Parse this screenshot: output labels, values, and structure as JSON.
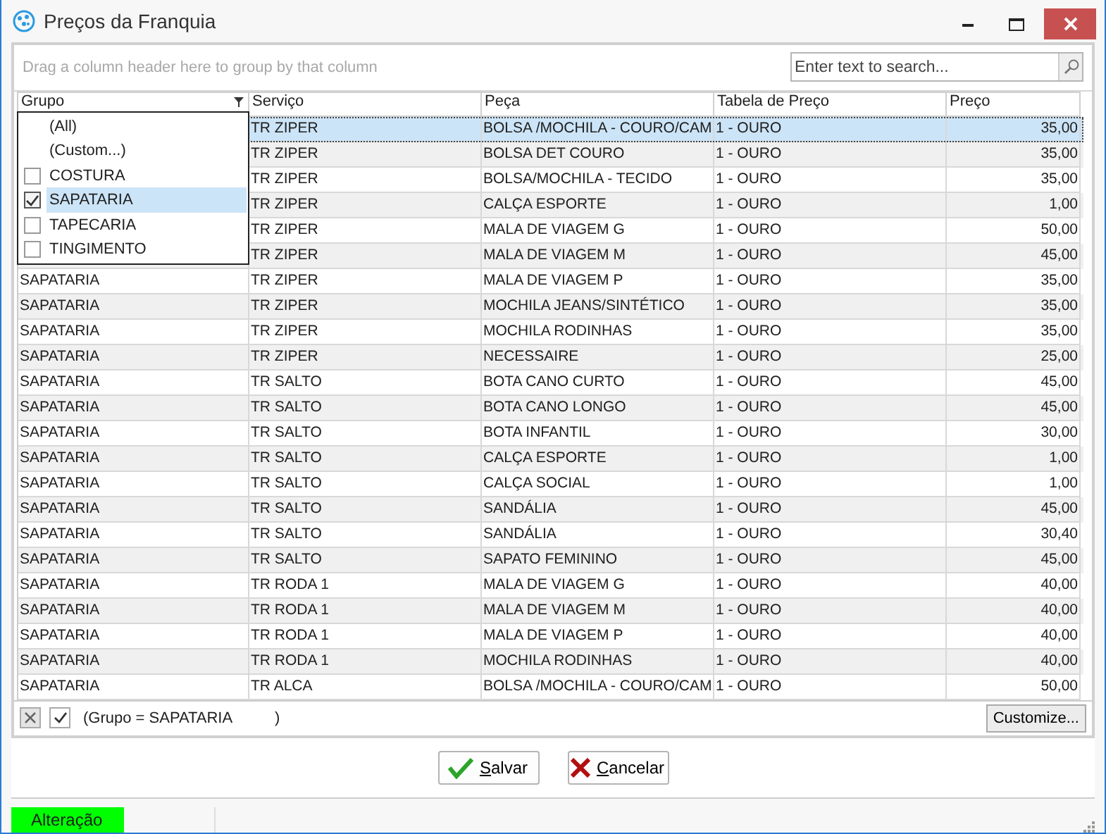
{
  "window": {
    "title": "Preços da Franquia"
  },
  "group_panel": {
    "hint": "Drag a column header here to group by that column"
  },
  "search": {
    "placeholder": "Enter text to search..."
  },
  "table": {
    "columns": [
      {
        "label": "Grupo",
        "filter": true
      },
      {
        "label": "Serviço",
        "filter": false
      },
      {
        "label": "Peça",
        "filter": false
      },
      {
        "label": "Tabela de Preço",
        "filter": false
      },
      {
        "label": "Preço",
        "filter": false
      }
    ],
    "rows": [
      {
        "selected": true,
        "cells": [
          "",
          "TR ZIPER",
          "BOLSA /MOCHILA - COURO/CAM",
          "1 - OURO",
          "35,00"
        ]
      },
      {
        "selected": false,
        "cells": [
          "",
          "TR ZIPER",
          "BOLSA DET COURO",
          "1 - OURO",
          "35,00"
        ]
      },
      {
        "selected": false,
        "cells": [
          "",
          "TR ZIPER",
          "BOLSA/MOCHILA - TECIDO",
          "1 - OURO",
          "35,00"
        ]
      },
      {
        "selected": false,
        "cells": [
          "",
          "TR ZIPER",
          "CALÇA ESPORTE",
          "1 - OURO",
          "1,00"
        ]
      },
      {
        "selected": false,
        "cells": [
          "",
          "TR ZIPER",
          "MALA DE VIAGEM G",
          "1 - OURO",
          "50,00"
        ]
      },
      {
        "selected": false,
        "cells": [
          "",
          "TR ZIPER",
          "MALA DE VIAGEM M",
          "1 - OURO",
          "45,00"
        ]
      },
      {
        "selected": false,
        "cells": [
          "SAPATARIA",
          "TR ZIPER",
          "MALA DE VIAGEM P",
          "1 - OURO",
          "35,00"
        ]
      },
      {
        "selected": false,
        "cells": [
          "SAPATARIA",
          "TR ZIPER",
          "MOCHILA JEANS/SINTÉTICO",
          "1 - OURO",
          "35,00"
        ]
      },
      {
        "selected": false,
        "cells": [
          "SAPATARIA",
          "TR ZIPER",
          "MOCHILA RODINHAS",
          "1 - OURO",
          "35,00"
        ]
      },
      {
        "selected": false,
        "cells": [
          "SAPATARIA",
          "TR ZIPER",
          "NECESSAIRE",
          "1 - OURO",
          "25,00"
        ]
      },
      {
        "selected": false,
        "cells": [
          "SAPATARIA",
          "TR SALTO",
          "BOTA CANO CURTO",
          "1 - OURO",
          "45,00"
        ]
      },
      {
        "selected": false,
        "cells": [
          "SAPATARIA",
          "TR SALTO",
          "BOTA CANO LONGO",
          "1 - OURO",
          "45,00"
        ]
      },
      {
        "selected": false,
        "cells": [
          "SAPATARIA",
          "TR SALTO",
          "BOTA INFANTIL",
          "1 - OURO",
          "30,00"
        ]
      },
      {
        "selected": false,
        "cells": [
          "SAPATARIA",
          "TR SALTO",
          "CALÇA ESPORTE",
          "1 - OURO",
          "1,00"
        ]
      },
      {
        "selected": false,
        "cells": [
          "SAPATARIA",
          "TR SALTO",
          "CALÇA SOCIAL",
          "1 - OURO",
          "1,00"
        ]
      },
      {
        "selected": false,
        "cells": [
          "SAPATARIA",
          "TR SALTO",
          "SANDÁLIA",
          "1 - OURO",
          "45,00"
        ]
      },
      {
        "selected": false,
        "cells": [
          "SAPATARIA",
          "TR SALTO",
          "SANDÁLIA",
          "1 - OURO",
          "30,40"
        ]
      },
      {
        "selected": false,
        "cells": [
          "SAPATARIA",
          "TR SALTO",
          "SAPATO FEMININO",
          "1 - OURO",
          "45,00"
        ]
      },
      {
        "selected": false,
        "cells": [
          "SAPATARIA",
          "TR RODA 1",
          "MALA DE VIAGEM G",
          "1 - OURO",
          "40,00"
        ]
      },
      {
        "selected": false,
        "cells": [
          "SAPATARIA",
          "TR RODA 1",
          "MALA DE VIAGEM M",
          "1 - OURO",
          "40,00"
        ]
      },
      {
        "selected": false,
        "cells": [
          "SAPATARIA",
          "TR RODA 1",
          "MALA DE VIAGEM P",
          "1 - OURO",
          "40,00"
        ]
      },
      {
        "selected": false,
        "cells": [
          "SAPATARIA",
          "TR RODA 1",
          "MOCHILA RODINHAS",
          "1 - OURO",
          "40,00"
        ]
      },
      {
        "selected": false,
        "cells": [
          "SAPATARIA",
          "TR ALCA",
          "BOLSA /MOCHILA - COURO/CAM",
          "1 - OURO",
          "50,00"
        ]
      }
    ]
  },
  "filter_dropdown": {
    "items": [
      {
        "kind": "special",
        "label": "(All)",
        "selected": false
      },
      {
        "kind": "special",
        "label": "(Custom...)",
        "selected": false
      },
      {
        "kind": "check",
        "label": "COSTURA",
        "checked": false,
        "selected": false
      },
      {
        "kind": "check",
        "label": "SAPATARIA",
        "checked": true,
        "selected": true
      },
      {
        "kind": "check",
        "label": "TAPECARIA",
        "checked": false,
        "selected": false
      },
      {
        "kind": "check",
        "label": "TINGIMENTO",
        "checked": false,
        "selected": false
      }
    ]
  },
  "filter_bar": {
    "enabled": true,
    "text": "(Grupo = SAPATARIA          )",
    "customize": "Customize..."
  },
  "buttons": [
    {
      "kind": "save",
      "accel": "S",
      "rest": "alvar"
    },
    {
      "kind": "cancel",
      "accel": "C",
      "rest": "ancelar"
    }
  ],
  "status_bar": {
    "text": "Alteração",
    "color": "#00ff00"
  }
}
